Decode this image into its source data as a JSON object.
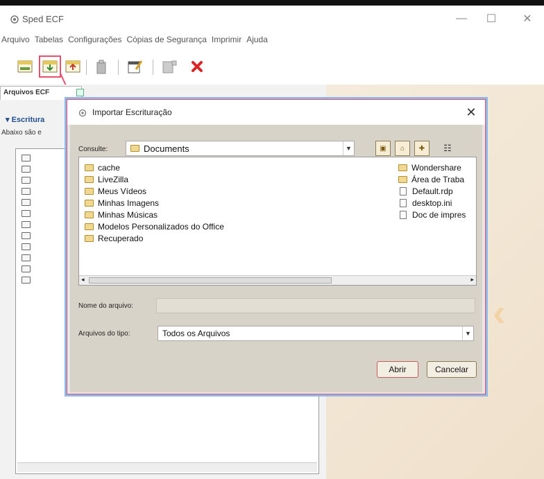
{
  "window": {
    "title": "Sped ECF",
    "minimize": "—",
    "maximize": "☐",
    "close": "✕"
  },
  "menu": [
    "Arquivo",
    "Tabelas",
    "Configurações",
    "Cópias de Segurança",
    "Imprimir",
    "Ajuda"
  ],
  "left_panel": {
    "tab_label": "Arquivos ECF",
    "section_title": "▾ Escritura",
    "section_desc": "Abaixo são e"
  },
  "dialog": {
    "title": "Importar Escrituração",
    "close": "✕",
    "lookin_label": "Consulte:",
    "lookin_value": "Documents",
    "files_left": [
      "cache",
      "LiveZilla",
      "Meus Vídeos",
      "Minhas Imagens",
      "Minhas Músicas",
      "Modelos Personalizados do Office",
      "Recuperado"
    ],
    "files_right": [
      {
        "name": "Wondershare",
        "kind": "folder"
      },
      {
        "name": "Área de Traba",
        "kind": "folder"
      },
      {
        "name": "Default.rdp",
        "kind": "file"
      },
      {
        "name": "desktop.ini",
        "kind": "file"
      },
      {
        "name": "Doc de impres",
        "kind": "file"
      }
    ],
    "filename_label": "Nome do arquivo:",
    "filename_value": "",
    "filetype_label": "Arquivos do tipo:",
    "filetype_value": "Todos os Arquivos",
    "open_button": "Abrir",
    "cancel_button": "Cancelar"
  },
  "colors": {
    "highlight": "#e6506a",
    "link_blue": "#1f4e8c",
    "dialog_body": "#d8d3c8",
    "folder": "#f1d890"
  }
}
